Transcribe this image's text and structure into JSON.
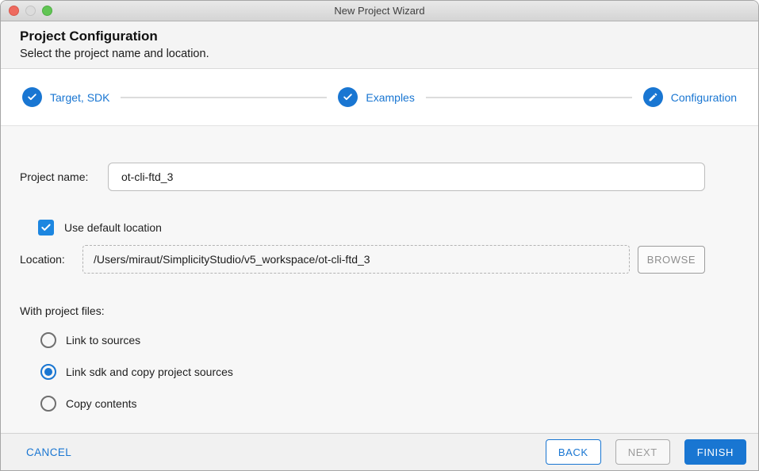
{
  "window": {
    "title": "New Project Wizard"
  },
  "titlebar_icons": [
    "close-traffic-light",
    "minimize-traffic-light",
    "zoom-traffic-light"
  ],
  "header": {
    "title": "Project Configuration",
    "subtitle": "Select the project name and location."
  },
  "stepper": {
    "steps": [
      {
        "label": "Target, SDK",
        "icon": "check-icon",
        "state": "complete"
      },
      {
        "label": "Examples",
        "icon": "check-icon",
        "state": "complete"
      },
      {
        "label": "Configuration",
        "icon": "pencil-icon",
        "state": "current"
      }
    ]
  },
  "form": {
    "project_name": {
      "label": "Project name:",
      "value": "ot-cli-ftd_3"
    },
    "use_default_location": {
      "label": "Use default location",
      "checked": true
    },
    "location": {
      "label": "Location:",
      "value": "/Users/miraut/SimplicityStudio/v5_workspace/ot-cli-ftd_3",
      "browse_label": "BROWSE"
    },
    "with_project_files": {
      "label": "With project files:",
      "options": [
        {
          "label": "Link to sources",
          "selected": false
        },
        {
          "label": "Link sdk and copy project sources",
          "selected": true
        },
        {
          "label": "Copy contents",
          "selected": false
        }
      ]
    }
  },
  "footer": {
    "cancel_label": "CANCEL",
    "back_label": "BACK",
    "next_label": "NEXT",
    "finish_label": "FINISH"
  },
  "colors": {
    "primary_blue": "#1976d2",
    "traffic_red": "#ee6a5f",
    "traffic_grey": "#dcdcdc",
    "traffic_green": "#61c554"
  }
}
